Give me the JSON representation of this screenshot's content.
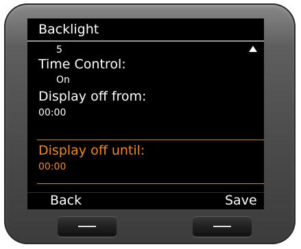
{
  "header": {
    "title": "Backlight"
  },
  "settings": {
    "value_top": "5",
    "time_control_label": "Time Control:",
    "time_control_value": "On",
    "display_off_from_label": "Display off from:",
    "display_off_from_value": "00:00",
    "display_off_until_label": "Display off until:",
    "display_off_until_value": "00:00"
  },
  "softkeys": {
    "left": "Back",
    "right": "Save"
  },
  "icons": {
    "scroll": "scroll-up-arrow-icon",
    "hardware_key": "dash-icon"
  },
  "colors": {
    "accent": "#f08a2b",
    "screen": "#000000",
    "text": "#ffffff"
  }
}
